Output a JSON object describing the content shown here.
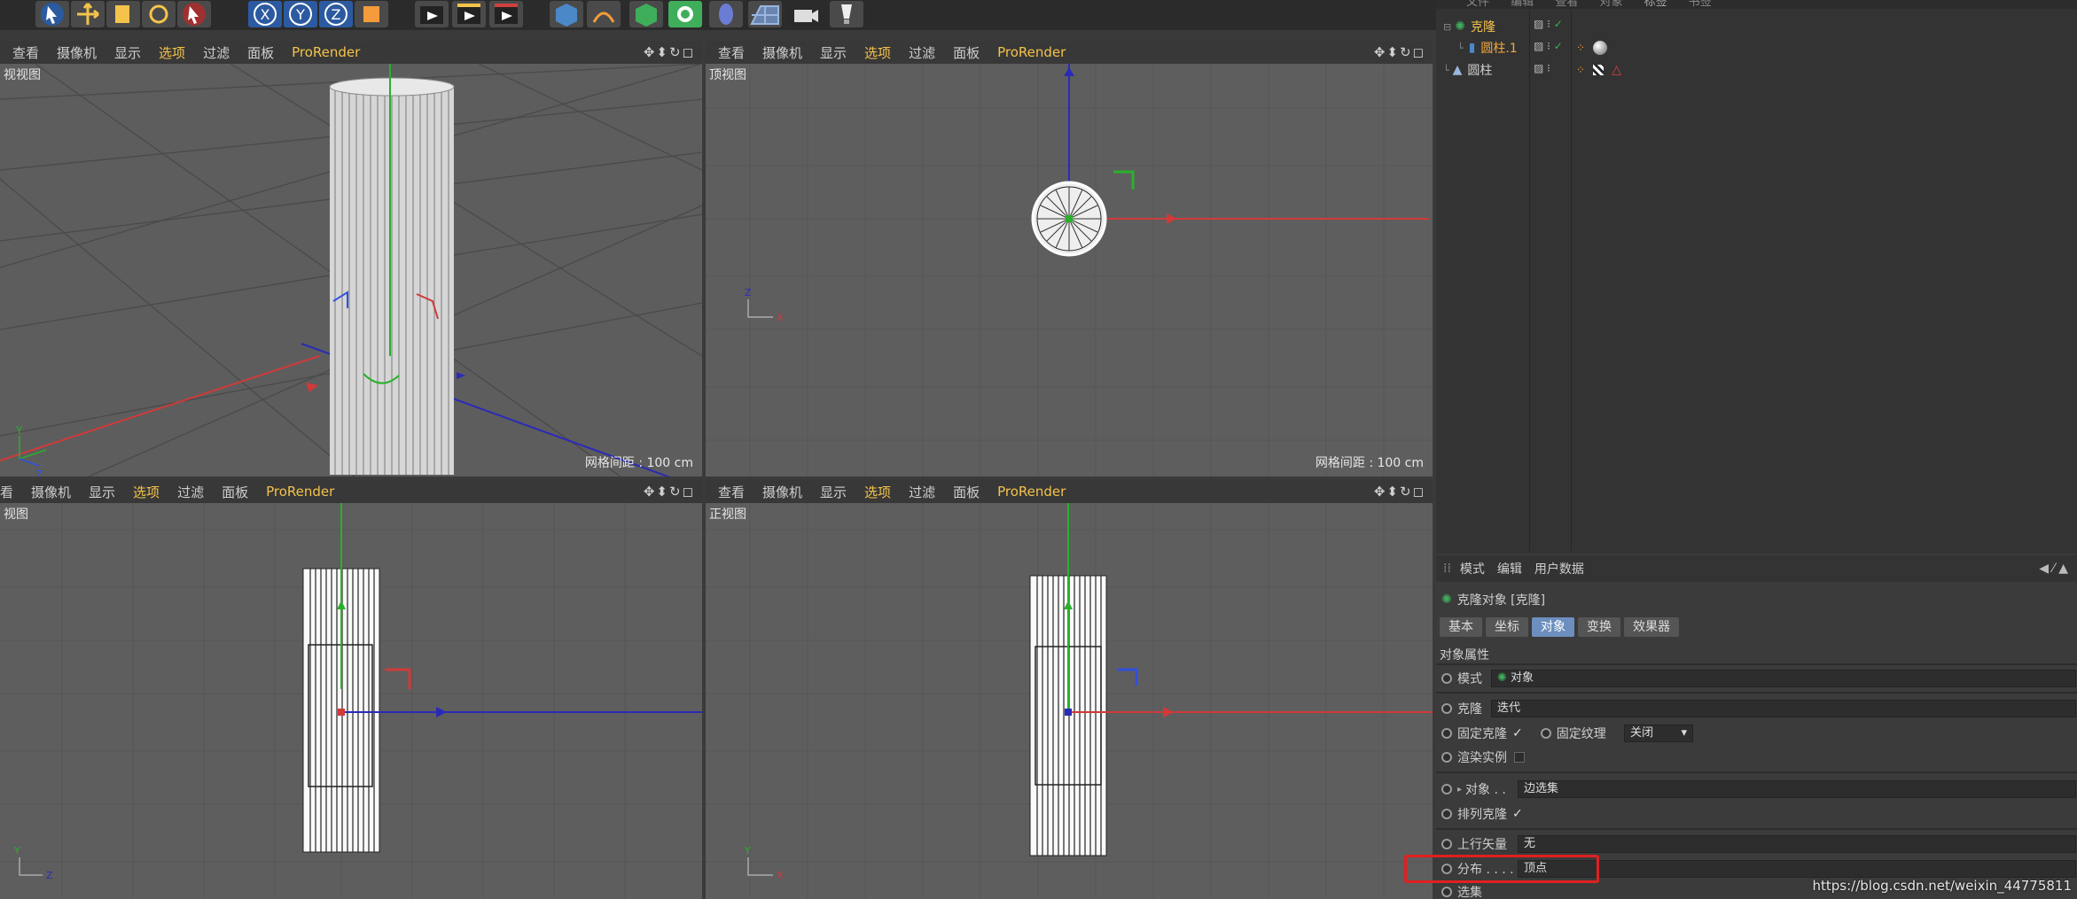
{
  "toolbar": {
    "buttons": [
      "select-arrow-icon",
      "move-icon",
      "scale-icon",
      "rotate-icon",
      "live-select-icon",
      "x-axis-icon",
      "y-axis-icon",
      "z-axis-icon",
      "coord-system-icon",
      "render-view-icon",
      "render-picture-icon",
      "render-settings-icon",
      "cube-icon",
      "pen-icon",
      "subdivision-icon",
      "mograph-icon",
      "deformer-icon",
      "floor-icon",
      "camera-icon",
      "light-icon"
    ]
  },
  "viewports": {
    "menu": [
      "查看",
      "摄像机",
      "显示",
      "选项",
      "过滤",
      "面板",
      "ProRender"
    ],
    "menu_bl": [
      "看",
      "摄像机",
      "显示",
      "选项",
      "过滤",
      "面板",
      "ProRender"
    ],
    "active_item": "选项",
    "nav_icons": "✥⬍↻◻",
    "perspective": {
      "title": "视视图",
      "grid": "网格间距 : 100 cm"
    },
    "top": {
      "title": "顶视图",
      "grid": "网格间距 : 100 cm"
    },
    "right": {
      "title": "视图"
    },
    "front": {
      "title": "正视图"
    },
    "axis_labels": {
      "x": "X",
      "y": "Y",
      "z": "Z"
    }
  },
  "object_manager": {
    "menu": [
      "文件",
      "编辑",
      "查看",
      "对象",
      "标签",
      "书签"
    ],
    "objects": [
      {
        "name": "克隆",
        "indent": 0,
        "color": "#f4c34b"
      },
      {
        "name": "圆柱.1",
        "indent": 1,
        "color": "#f4a83b"
      },
      {
        "name": "圆柱",
        "indent": 0,
        "color": "#cfcfcf"
      }
    ]
  },
  "attribute_manager": {
    "menu": [
      "模式",
      "编辑",
      "用户数据"
    ],
    "object_title": "克隆对象 [克隆]",
    "tabs": [
      "基本",
      "坐标",
      "对象",
      "变换",
      "效果器"
    ],
    "active_tab": "对象",
    "section": "对象属性",
    "props": {
      "mode_label": "模式",
      "mode_value": "对象",
      "clone_label": "克隆",
      "clone_value": "迭代",
      "fix_clone_label": "固定克隆",
      "fix_clone_check": "✓",
      "fix_texture_label": "固定纹理",
      "fix_texture_value": "关闭",
      "render_instance_label": "渲染实例",
      "object_label": "对象 . .",
      "object_value": "边选集",
      "arrange_label": "排列克隆",
      "arrange_check": "✓",
      "up_vector_label": "上行矢量",
      "up_vector_value": "无",
      "distribution_label": "分布 . . . .",
      "distribution_value": "顶点",
      "next_label": "选集"
    }
  },
  "watermark": "https://blog.csdn.net/weixin_44775811",
  "colors": {
    "highlight": "#e02020",
    "accent": "#f4c34b",
    "tab_active": "#6d8fbf"
  }
}
